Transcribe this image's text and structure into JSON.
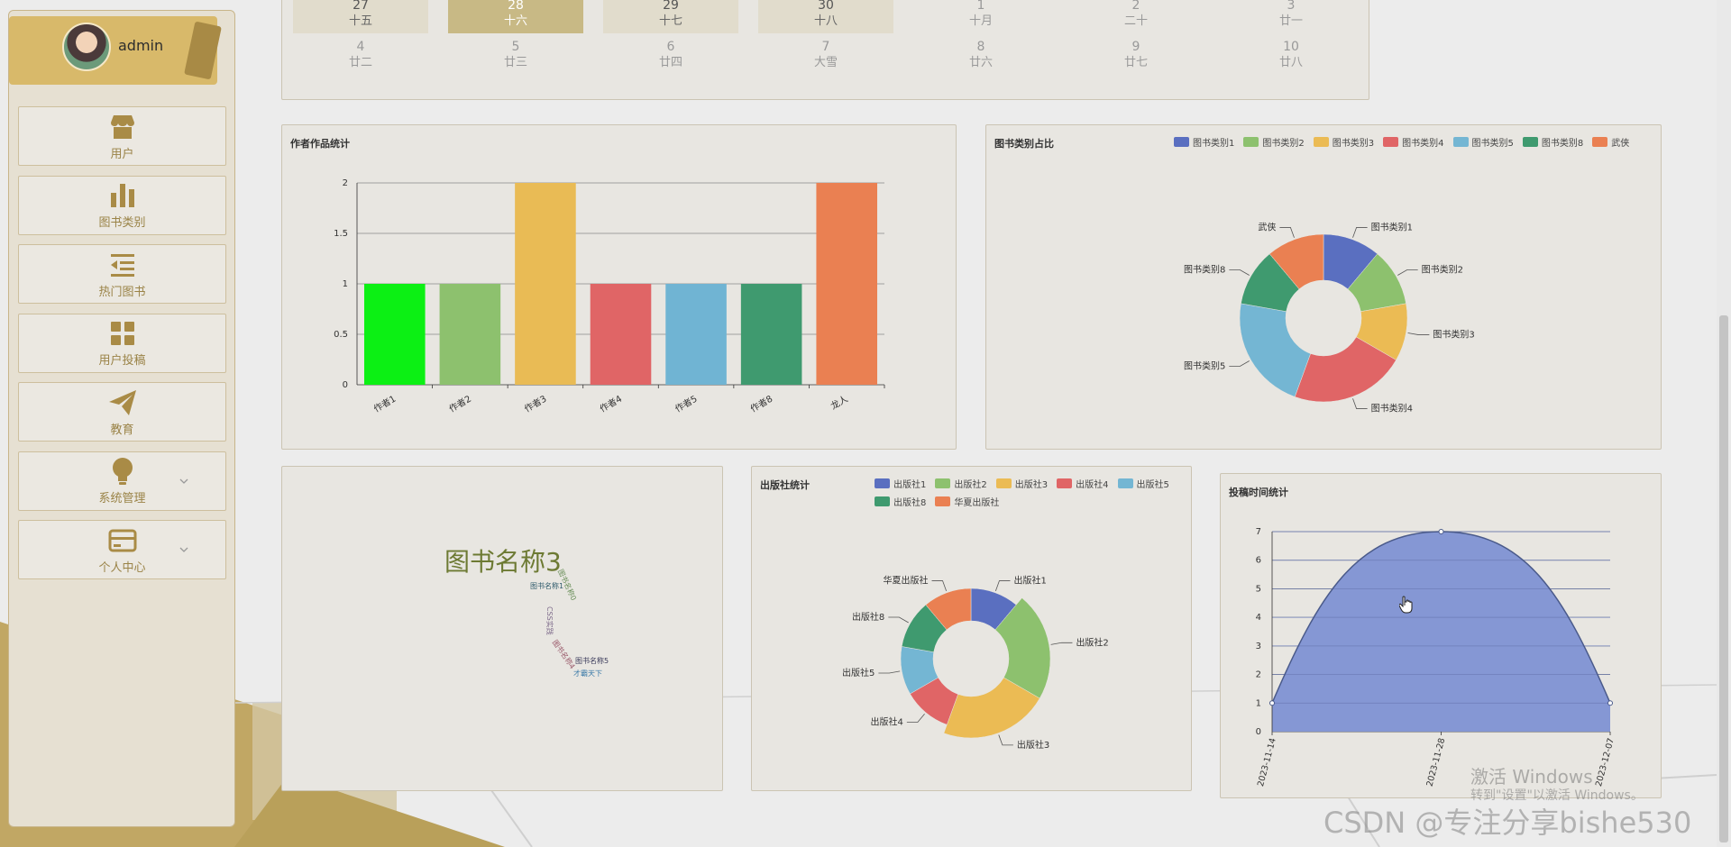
{
  "user": {
    "name": "admin"
  },
  "menu": [
    {
      "label": "用户",
      "icon": "store-icon"
    },
    {
      "label": "图书类别",
      "icon": "bar-chart-icon"
    },
    {
      "label": "热门图书",
      "icon": "list-indent-icon"
    },
    {
      "label": "用户投稿",
      "icon": "grid-icon"
    },
    {
      "label": "教育",
      "icon": "paper-plane-icon"
    },
    {
      "label": "系统管理",
      "icon": "lightbulb-icon",
      "expandable": true
    },
    {
      "label": "个人中心",
      "icon": "card-icon",
      "expandable": true
    }
  ],
  "calendar": {
    "row1": [
      {
        "day": "27",
        "lunar": "十五",
        "state": "hl"
      },
      {
        "day": "28",
        "lunar": "十六",
        "state": "sel"
      },
      {
        "day": "29",
        "lunar": "十七",
        "state": "hl"
      },
      {
        "day": "30",
        "lunar": "十八",
        "state": "hl"
      },
      {
        "day": "1",
        "lunar": "十月",
        "state": "muted"
      },
      {
        "day": "2",
        "lunar": "二十",
        "state": "muted"
      },
      {
        "day": "3",
        "lunar": "廿一",
        "state": "muted"
      }
    ],
    "row2": [
      {
        "day": "4",
        "lunar": "廿二",
        "state": "muted"
      },
      {
        "day": "5",
        "lunar": "廿三",
        "state": "muted"
      },
      {
        "day": "6",
        "lunar": "廿四",
        "state": "muted"
      },
      {
        "day": "7",
        "lunar": "大雪",
        "state": "muted"
      },
      {
        "day": "8",
        "lunar": "廿六",
        "state": "muted"
      },
      {
        "day": "9",
        "lunar": "廿七",
        "state": "muted"
      },
      {
        "day": "10",
        "lunar": "廿八",
        "state": "muted"
      }
    ]
  },
  "panels": {
    "author": "作者作品统计",
    "category": "图书类别占比",
    "publisher": "出版社统计",
    "submit_time": "投稿时间统计"
  },
  "chart_data": [
    {
      "type": "bar",
      "title": "作者作品统计",
      "categories": [
        "作者1",
        "作者2",
        "作者3",
        "作者4",
        "作者5",
        "作者8",
        "龙人"
      ],
      "values": [
        1,
        1,
        2,
        1,
        1,
        1,
        2
      ],
      "colors": [
        "#0cf014",
        "#8dc16e",
        "#e9bb55",
        "#e06566",
        "#70b4d3",
        "#3f9a6f",
        "#ea8052"
      ],
      "ylim": [
        0,
        2
      ],
      "yticks": [
        "0",
        "0.5",
        "1",
        "1.5",
        "2"
      ]
    },
    {
      "type": "pie",
      "title": "图书类别占比",
      "donut": true,
      "labels": [
        "图书类别1",
        "图书类别2",
        "图书类别3",
        "图书类别4",
        "图书类别5",
        "图书类别8",
        "武侠"
      ],
      "values": [
        1,
        1,
        1,
        2,
        2,
        1,
        1
      ],
      "colors": [
        "#5a6fc0",
        "#8dc16e",
        "#ebbb54",
        "#e06566",
        "#74b6d3",
        "#3f9a6f",
        "#ea8052"
      ],
      "legend": "top-right"
    },
    {
      "type": "pie",
      "title": "出版社统计",
      "donut": true,
      "rose": true,
      "labels": [
        "出版社1",
        "出版社2",
        "出版社3",
        "出版社4",
        "出版社5",
        "出版社8",
        "华夏出版社"
      ],
      "values": [
        1,
        2,
        2,
        1,
        1,
        1,
        1
      ],
      "colors": [
        "#5a6fc0",
        "#8dc16e",
        "#ebbb54",
        "#e06566",
        "#74b6d3",
        "#3f9a6f",
        "#ea8052"
      ],
      "legend": "top"
    },
    {
      "type": "area",
      "title": "投稿时间统计",
      "x": [
        "2023-11-14",
        "2023-11-28",
        "2023-12-07"
      ],
      "values": [
        1,
        7,
        1
      ],
      "ylim": [
        0,
        7
      ],
      "yticks": [
        "0",
        "1",
        "2",
        "3",
        "4",
        "5",
        "6",
        "7"
      ],
      "color": "#8092d3"
    }
  ],
  "wordcloud": {
    "words": [
      {
        "text": "图书名称3",
        "color": "#6d7a33"
      },
      {
        "text": "图书名称1",
        "color": "#2e5a6b"
      },
      {
        "text": "图书名称0",
        "color": "#6a8f5a"
      },
      {
        "text": "CSS实践",
        "color": "#7d6a8a"
      },
      {
        "text": "图书名称4",
        "color": "#9a5a6b"
      },
      {
        "text": "图书名称5",
        "color": "#3a3a5a"
      },
      {
        "text": "才霸天下",
        "color": "#3a7aa8"
      }
    ]
  },
  "watermark": {
    "line1": "激活 Windows",
    "line2": "转到\"设置\"以激活 Windows。",
    "csdn": "CSDN @专注分享bishe530"
  }
}
